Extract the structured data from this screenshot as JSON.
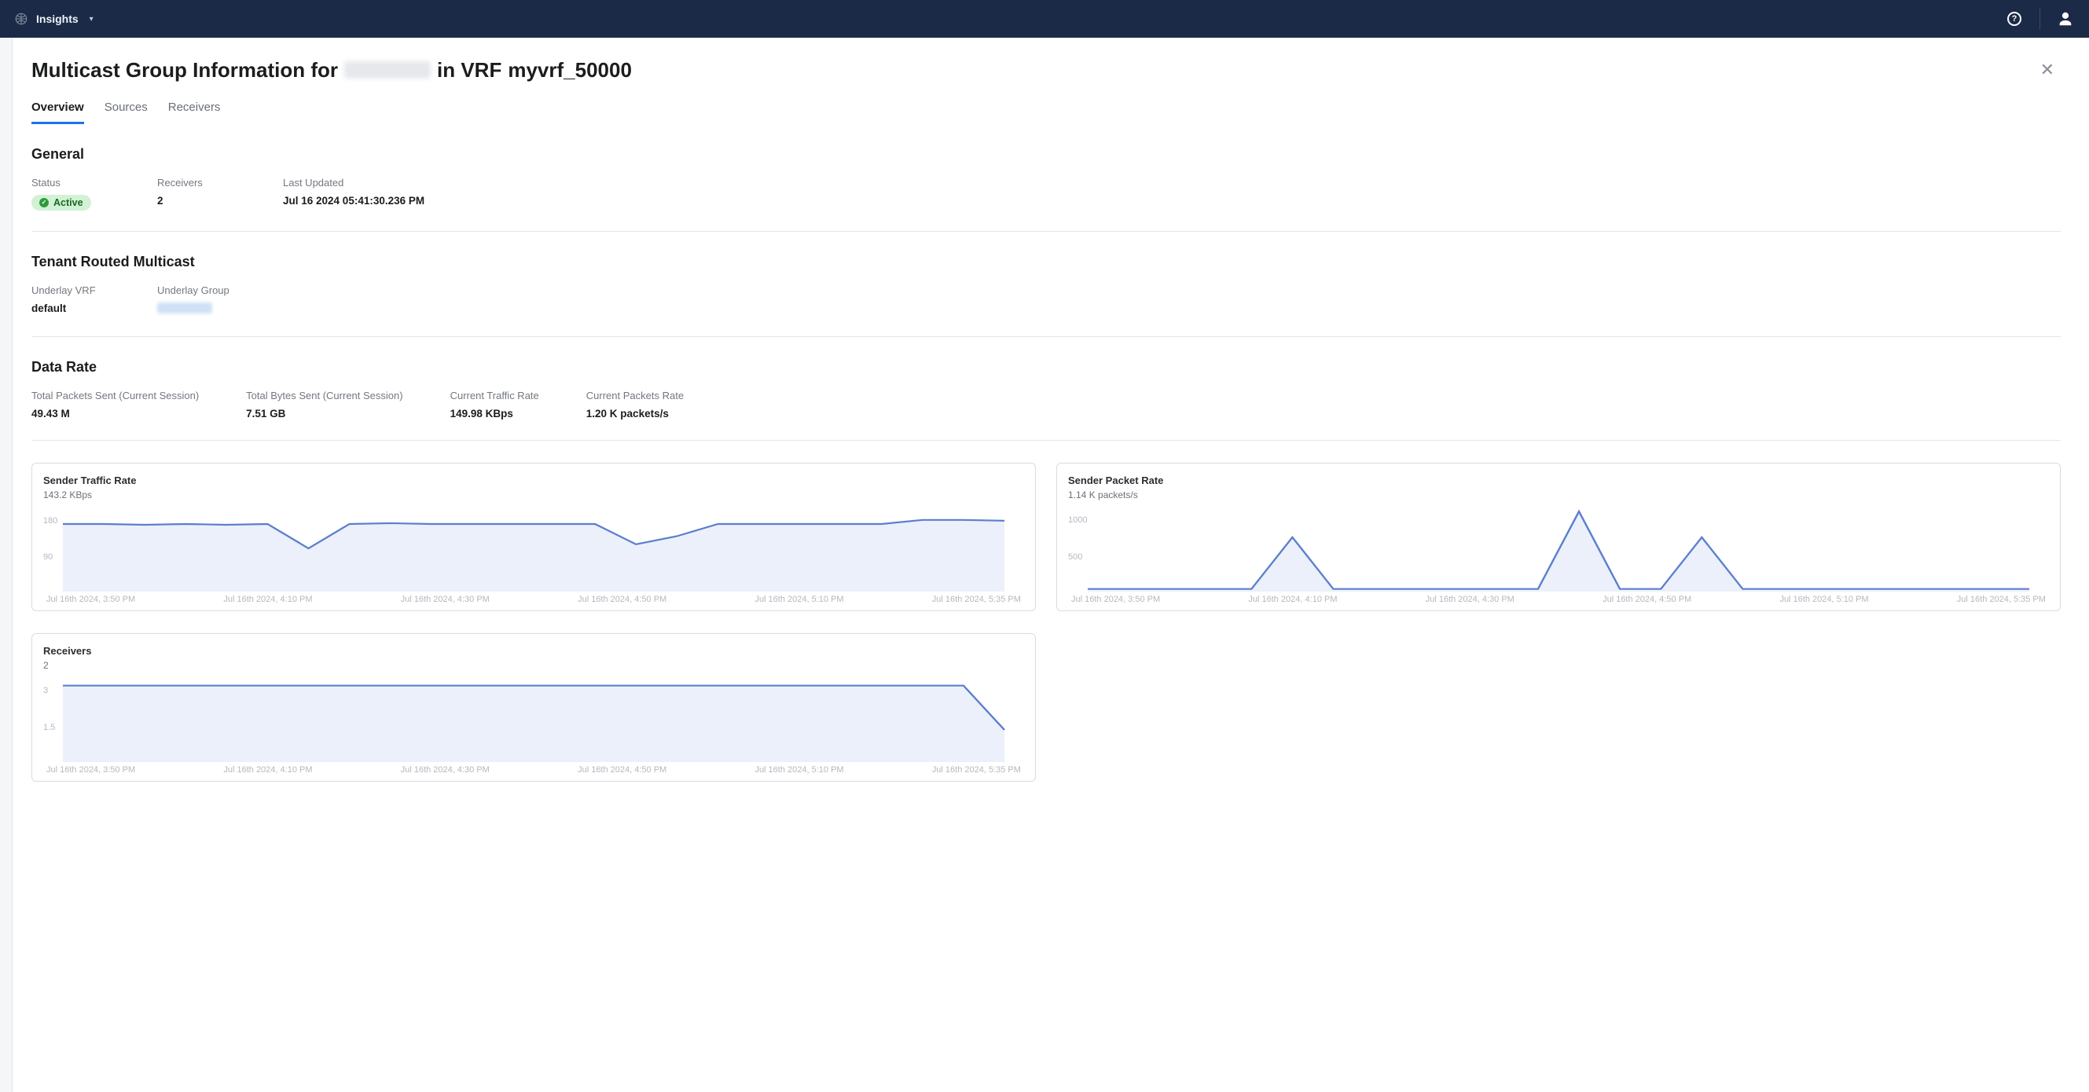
{
  "topbar": {
    "brand": "Insights"
  },
  "page_title": {
    "prefix": "Multicast Group Information for",
    "suffix_vrf_prefix": "in VRF",
    "vrf_name": "myvrf_50000"
  },
  "tabs": [
    {
      "label": "Overview",
      "active": true
    },
    {
      "label": "Sources",
      "active": false
    },
    {
      "label": "Receivers",
      "active": false
    }
  ],
  "sections": {
    "general": {
      "title": "General",
      "status_label": "Status",
      "status_value": "Active",
      "receivers_label": "Receivers",
      "receivers_value": "2",
      "last_updated_label": "Last Updated",
      "last_updated_value": "Jul 16 2024 05:41:30.236 PM"
    },
    "trm": {
      "title": "Tenant Routed Multicast",
      "underlay_vrf_label": "Underlay VRF",
      "underlay_vrf_value": "default",
      "underlay_group_label": "Underlay Group",
      "underlay_group_value": "[redacted]"
    },
    "data_rate": {
      "title": "Data Rate",
      "total_packets_label": "Total Packets Sent (Current Session)",
      "total_packets_value": "49.43 M",
      "total_bytes_label": "Total Bytes Sent (Current Session)",
      "total_bytes_value": "7.51 GB",
      "current_traffic_label": "Current Traffic Rate",
      "current_traffic_value": "149.98 KBps",
      "current_packets_label": "Current Packets Rate",
      "current_packets_value": "1.20 K packets/s"
    }
  },
  "chart_data": [
    {
      "type": "area",
      "title": "Sender Traffic Rate",
      "subtitle": "143.2 KBps",
      "categories": [
        "Jul 16th 2024, 3:50 PM",
        "Jul 16th 2024, 4:10 PM",
        "Jul 16th 2024, 4:30 PM",
        "Jul 16th 2024, 4:50 PM",
        "Jul 16th 2024, 5:10 PM",
        "Jul 16th 2024, 5:35 PM"
      ],
      "y_ticks": [
        90,
        180
      ],
      "ylim": [
        0,
        200
      ],
      "values": [
        160,
        160,
        158,
        160,
        158,
        160,
        100,
        160,
        162,
        160,
        160,
        160,
        160,
        160,
        110,
        130,
        160,
        160,
        160,
        160,
        160,
        170,
        170,
        168
      ]
    },
    {
      "type": "area",
      "title": "Sender Packet Rate",
      "subtitle": "1.14 K packets/s",
      "categories": [
        "Jul 16th 2024, 3:50 PM",
        "Jul 16th 2024, 4:10 PM",
        "Jul 16th 2024, 4:30 PM",
        "Jul 16th 2024, 4:50 PM",
        "Jul 16th 2024, 5:10 PM",
        "Jul 16th 2024, 5:35 PM"
      ],
      "y_ticks": [
        500,
        1000
      ],
      "ylim": [
        0,
        1100
      ],
      "values": [
        0,
        0,
        0,
        0,
        0,
        700,
        0,
        0,
        0,
        0,
        0,
        0,
        1050,
        0,
        0,
        700,
        0,
        0,
        0,
        0,
        0,
        0,
        0,
        0
      ]
    },
    {
      "type": "area",
      "title": "Receivers",
      "subtitle": "2",
      "categories": [
        "Jul 16th 2024, 3:50 PM",
        "Jul 16th 2024, 4:10 PM",
        "Jul 16th 2024, 4:30 PM",
        "Jul 16th 2024, 4:50 PM",
        "Jul 16th 2024, 5:10 PM",
        "Jul 16th 2024, 5:35 PM"
      ],
      "y_ticks": [
        1.5,
        3
      ],
      "ylim": [
        0,
        3.3
      ],
      "values": [
        3,
        3,
        3,
        3,
        3,
        3,
        3,
        3,
        3,
        3,
        3,
        3,
        3,
        3,
        3,
        3,
        3,
        3,
        3,
        3,
        3,
        3,
        3,
        1.2
      ]
    }
  ]
}
